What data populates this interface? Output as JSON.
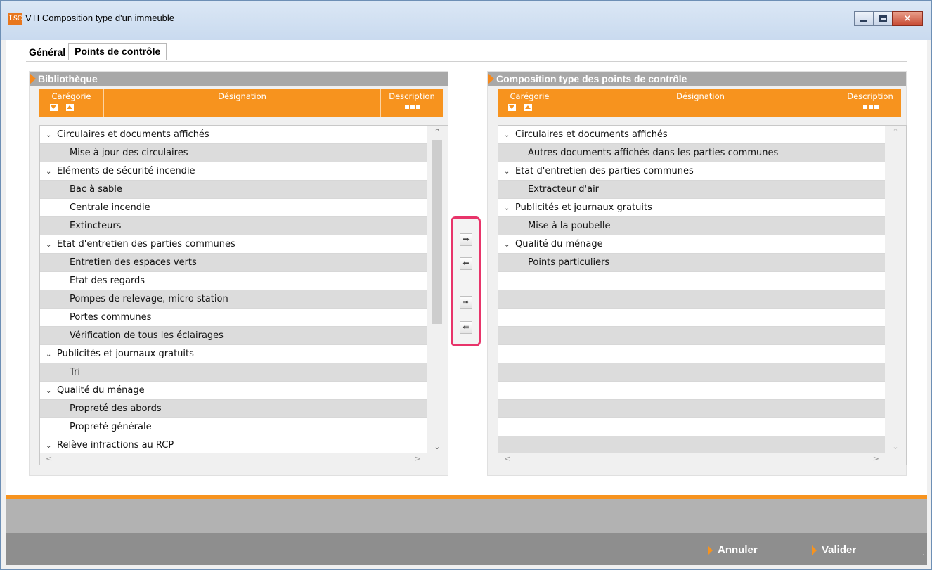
{
  "window": {
    "logo": "LSC",
    "title": "VTI Composition type d'un immeuble",
    "close_glyph": "✕"
  },
  "tabs": [
    {
      "label": "Général",
      "active": false
    },
    {
      "label": "Points de contrôle",
      "active": true
    }
  ],
  "left_panel": {
    "title": "Bibliothèque",
    "columns": {
      "category": "Carégorie",
      "designation": "Désignation",
      "description": "Description"
    },
    "rows": [
      {
        "type": "group",
        "label": "Circulaires et documents affichés"
      },
      {
        "type": "item",
        "label": "Mise à jour des circulaires"
      },
      {
        "type": "group",
        "label": "Eléments de sécurité incendie"
      },
      {
        "type": "item",
        "label": "Bac à sable"
      },
      {
        "type": "item",
        "label": "Centrale incendie"
      },
      {
        "type": "item",
        "label": "Extincteurs"
      },
      {
        "type": "group",
        "label": "Etat d'entretien des parties communes"
      },
      {
        "type": "item",
        "label": "Entretien des espaces verts"
      },
      {
        "type": "item",
        "label": "Etat des regards"
      },
      {
        "type": "item",
        "label": "Pompes de relevage, micro station"
      },
      {
        "type": "item",
        "label": "Portes communes"
      },
      {
        "type": "item",
        "label": "Vérification de tous les éclairages"
      },
      {
        "type": "group",
        "label": "Publicités et journaux gratuits"
      },
      {
        "type": "item",
        "label": "Tri"
      },
      {
        "type": "group",
        "label": "Qualité du ménage"
      },
      {
        "type": "item",
        "label": "Propreté des abords"
      },
      {
        "type": "item",
        "label": "Propreté générale"
      },
      {
        "type": "group",
        "label": "Relève infractions au RCP"
      }
    ]
  },
  "right_panel": {
    "title": "Composition type des points de contrôle",
    "columns": {
      "category": "Carégorie",
      "designation": "Désignation",
      "description": "Description"
    },
    "rows": [
      {
        "type": "group",
        "label": "Circulaires et documents affichés"
      },
      {
        "type": "item",
        "label": "Autres documents affichés dans les parties communes"
      },
      {
        "type": "group",
        "label": "Etat d'entretien des parties communes"
      },
      {
        "type": "item",
        "label": "Extracteur d'air"
      },
      {
        "type": "group",
        "label": "Publicités et journaux gratuits"
      },
      {
        "type": "item",
        "label": "Mise à la poubelle"
      },
      {
        "type": "group",
        "label": "Qualité du ménage"
      },
      {
        "type": "item",
        "label": "Points particuliers"
      }
    ],
    "empty_rows": 10
  },
  "transfer_buttons": [
    {
      "name": "move-right-button",
      "icon": "arrow-right-icon"
    },
    {
      "name": "move-left-button",
      "icon": "arrow-left-icon"
    },
    {
      "name": "move-all-right-button",
      "icon": "double-arrow-right-icon"
    },
    {
      "name": "move-all-left-button",
      "icon": "double-arrow-left-icon"
    }
  ],
  "footer": {
    "cancel_label": "Annuler",
    "validate_label": "Valider"
  },
  "colors": {
    "accent": "#f7931e",
    "highlight_border": "#e8346a",
    "panel_title_bg": "#a8a8a8",
    "footer_bg": "#8e8e8e"
  }
}
